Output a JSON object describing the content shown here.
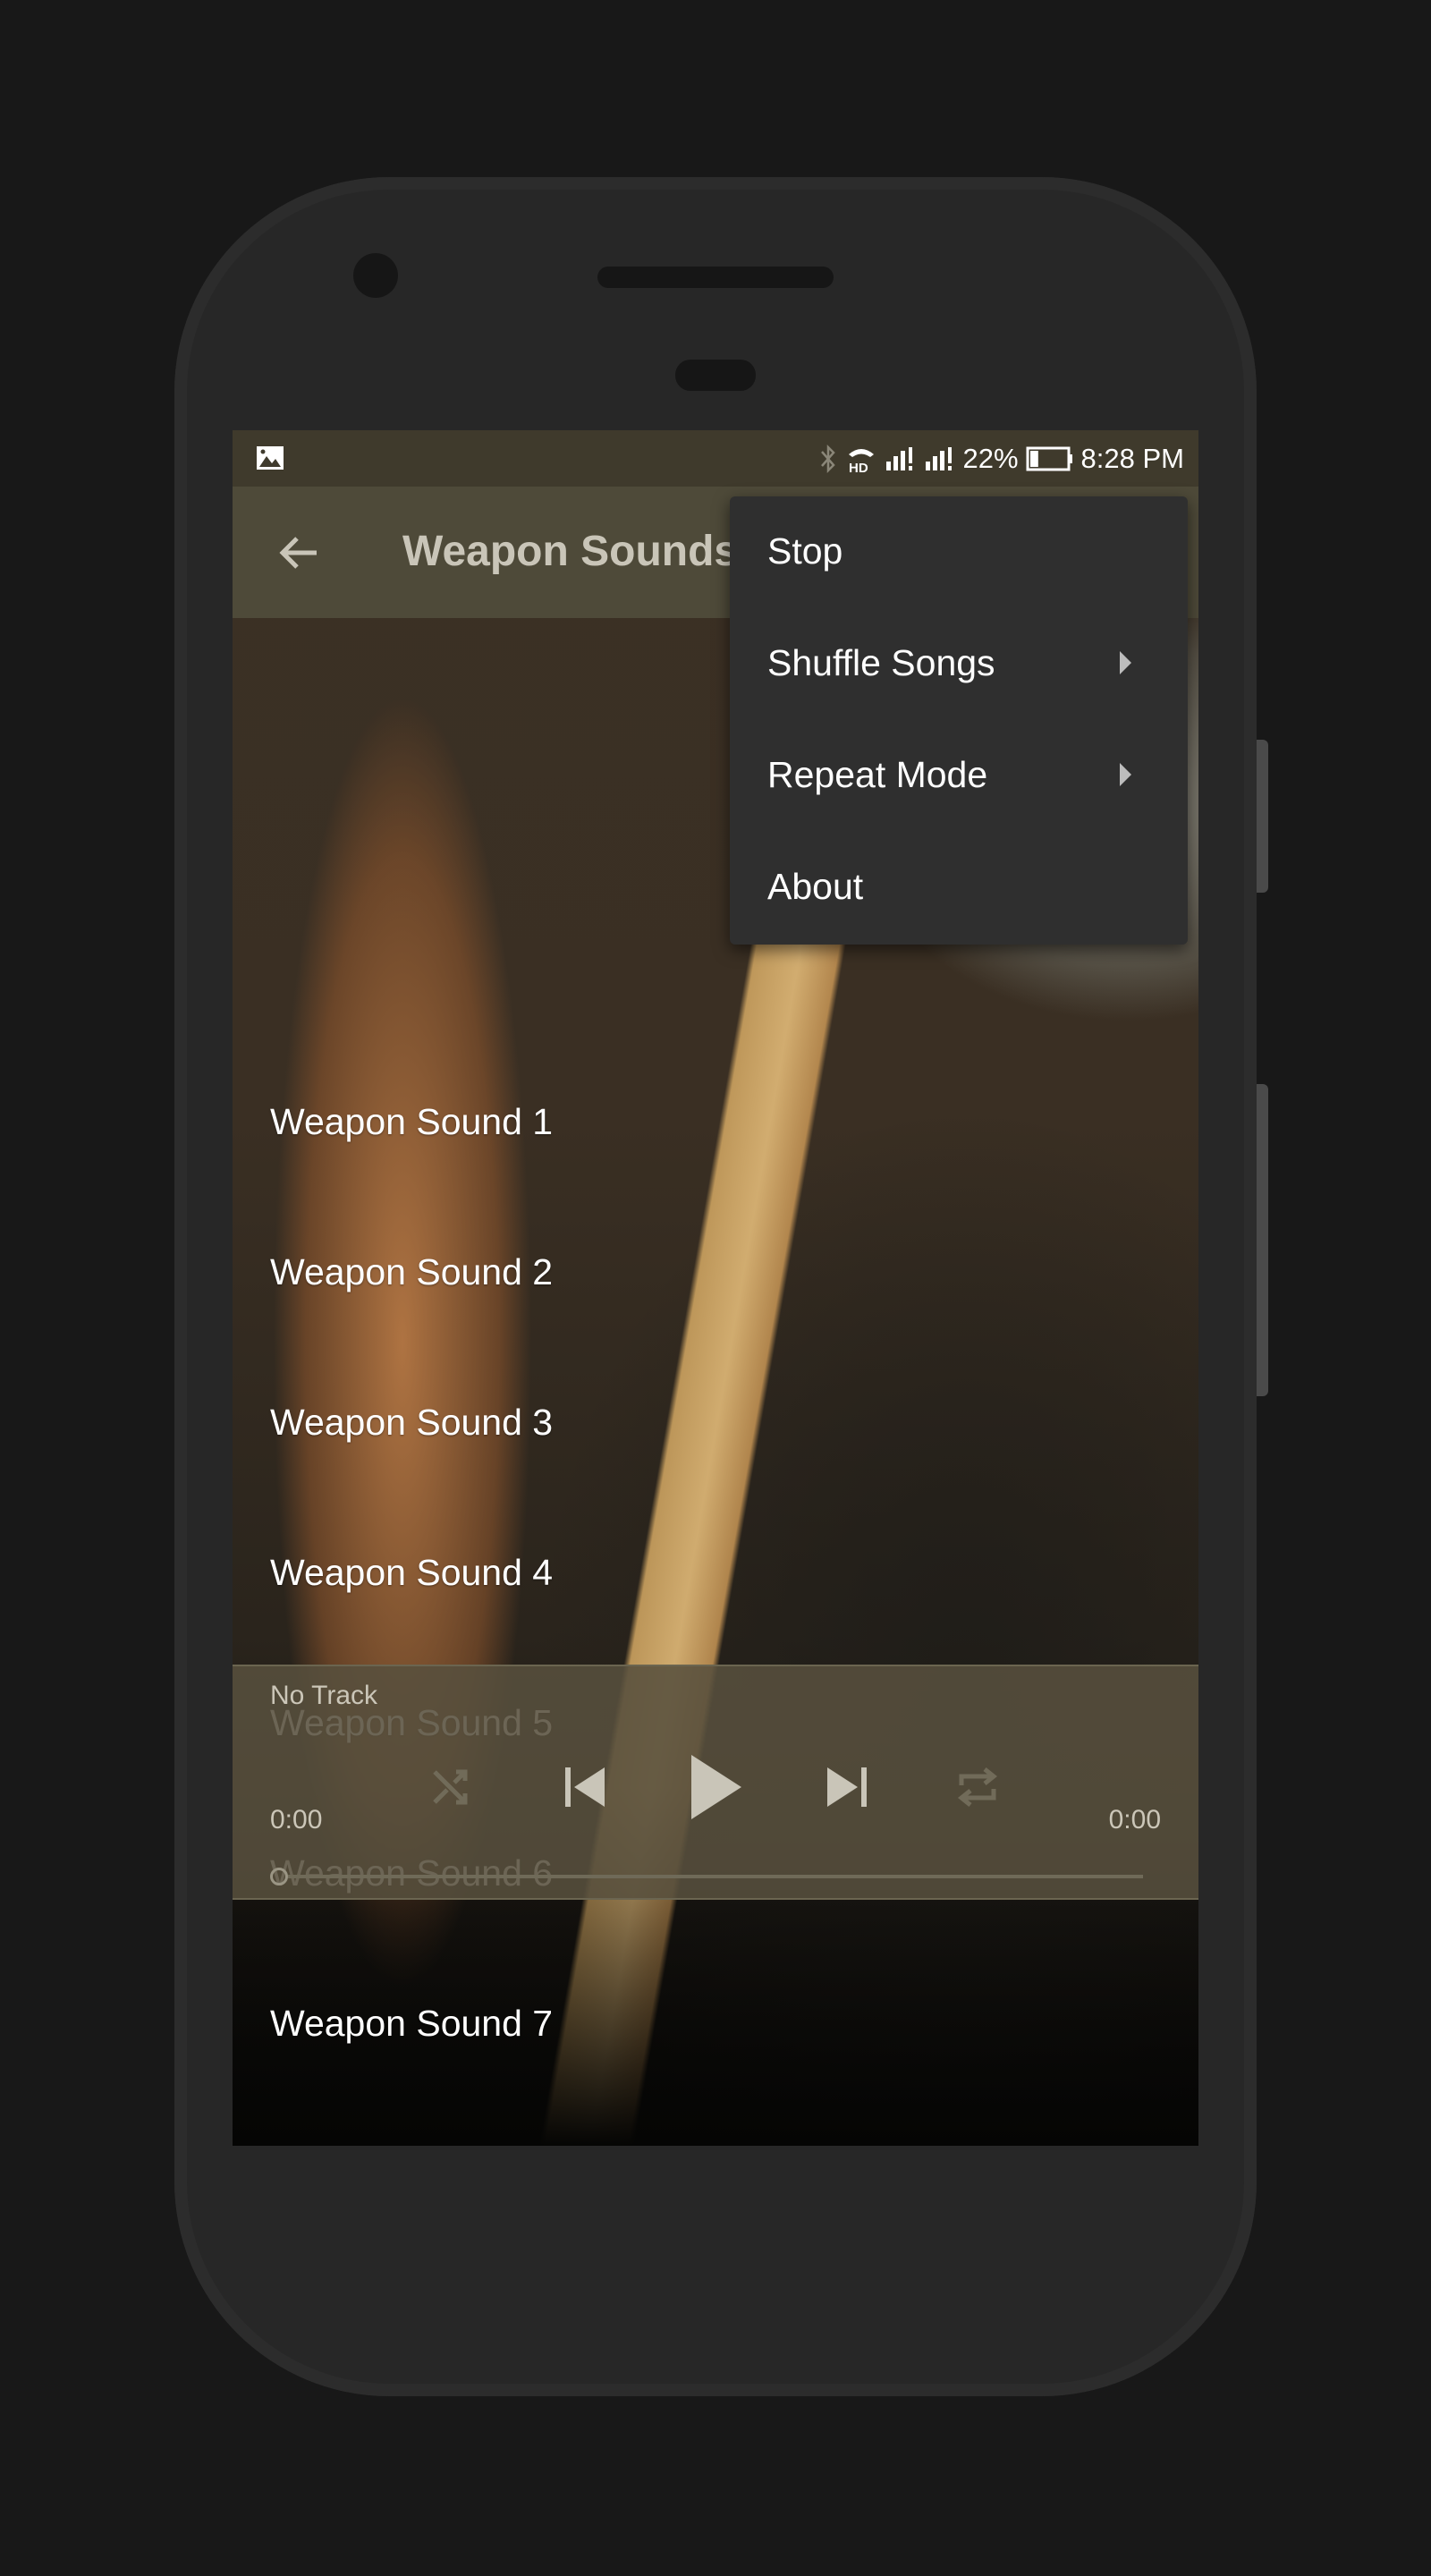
{
  "status_bar": {
    "notification_icon": "image-icon",
    "icons": [
      "bluetooth-icon",
      "hd-call-icon",
      "signal-sim1-icon",
      "signal-sim2-icon"
    ],
    "battery_percent": "22%",
    "battery_level": 0.22,
    "time": "8:28 PM"
  },
  "app_bar": {
    "back_icon": "arrow-back-icon",
    "title": "Weapon Sounds"
  },
  "list": {
    "items": [
      {
        "label": "Weapon Sound 1"
      },
      {
        "label": "Weapon Sound 2"
      },
      {
        "label": "Weapon Sound 3"
      },
      {
        "label": "Weapon Sound 4"
      },
      {
        "label": "Weapon Sound 5"
      },
      {
        "label": "Weapon Sound 6"
      },
      {
        "label": "Weapon Sound 7"
      }
    ]
  },
  "player": {
    "track_name": "No Track",
    "elapsed": "0:00",
    "duration": "0:00",
    "progress": 0,
    "controls": [
      "shuffle-icon",
      "skip-previous-icon",
      "play-icon",
      "skip-next-icon",
      "repeat-icon"
    ]
  },
  "overflow_menu": {
    "items": [
      {
        "label": "Stop",
        "has_submenu": false
      },
      {
        "label": "Shuffle Songs",
        "has_submenu": true
      },
      {
        "label": "Repeat Mode",
        "has_submenu": true
      },
      {
        "label": "About",
        "has_submenu": false
      }
    ]
  },
  "colors": {
    "status_bar": "#3f3a2c",
    "app_bar": "#4e4a39",
    "menu_bg": "#2f2f2f",
    "player_bg": "#58503e",
    "title_text": "#c9c5b8"
  }
}
